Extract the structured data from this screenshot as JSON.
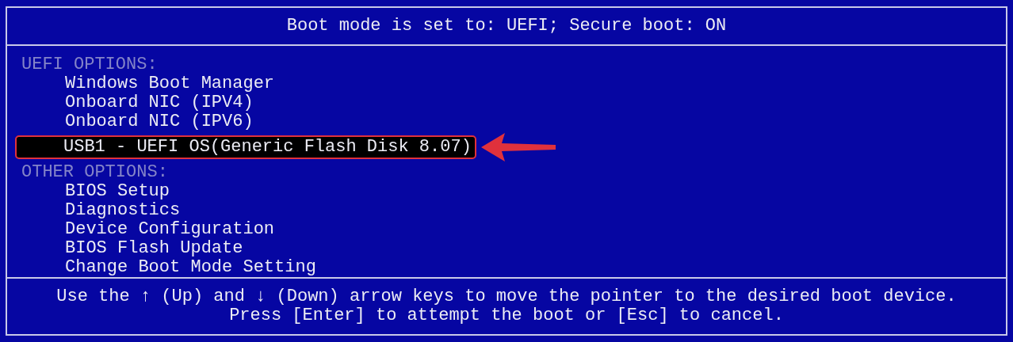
{
  "header": "Boot mode is set to: UEFI; Secure boot: ON",
  "sections": [
    {
      "heading": "UEFI OPTIONS:",
      "items": [
        {
          "label": "Windows Boot Manager",
          "selected": false
        },
        {
          "label": "Onboard NIC (IPV4)",
          "selected": false
        },
        {
          "label": "Onboard NIC (IPV6)",
          "selected": false
        },
        {
          "label": "USB1 - UEFI OS(Generic Flash Disk 8.07)",
          "selected": true
        }
      ]
    },
    {
      "heading": "OTHER OPTIONS:",
      "items": [
        {
          "label": "BIOS Setup",
          "selected": false
        },
        {
          "label": "Diagnostics",
          "selected": false
        },
        {
          "label": "Device Configuration",
          "selected": false
        },
        {
          "label": "BIOS Flash Update",
          "selected": false
        },
        {
          "label": "Change Boot Mode Setting",
          "selected": false
        }
      ]
    }
  ],
  "footer": [
    "Use the ↑ (Up) and ↓ (Down) arrow keys to move the pointer to the desired boot device.",
    "Press [Enter] to attempt the boot or [Esc] to cancel."
  ]
}
